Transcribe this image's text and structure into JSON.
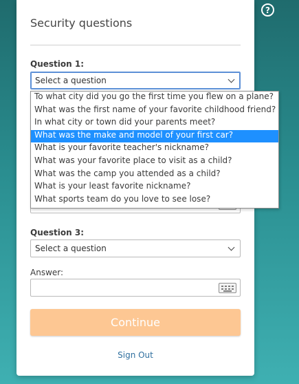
{
  "help": {
    "glyph": "?"
  },
  "card": {
    "title": "Security questions",
    "question1": {
      "label": "Question 1:",
      "value": "Select a question"
    },
    "question3": {
      "label": "Question 3:",
      "value": "Select a question"
    },
    "answer": {
      "label": "Answer:",
      "value": ""
    },
    "continue_label": "Continue",
    "signout_label": "Sign Out"
  },
  "dropdown": {
    "selected_index": 3,
    "options": [
      "To what city did you go the first time you flew on a plane?",
      "What was the first name of your favorite childhood friend?",
      "In what city or town did your parents meet?",
      "What was the make and model of your first car?",
      "What is your favorite teacher's nickname?",
      "What was your favorite place to visit as a child?",
      "What was the camp you attended as a child?",
      "What is your least favorite nickname?",
      "What sports team do you love to see lose?"
    ]
  },
  "colors": {
    "continue_bg": "#fdc793",
    "selected_option_bg": "#1e90ff",
    "link": "#2f6f9f"
  }
}
